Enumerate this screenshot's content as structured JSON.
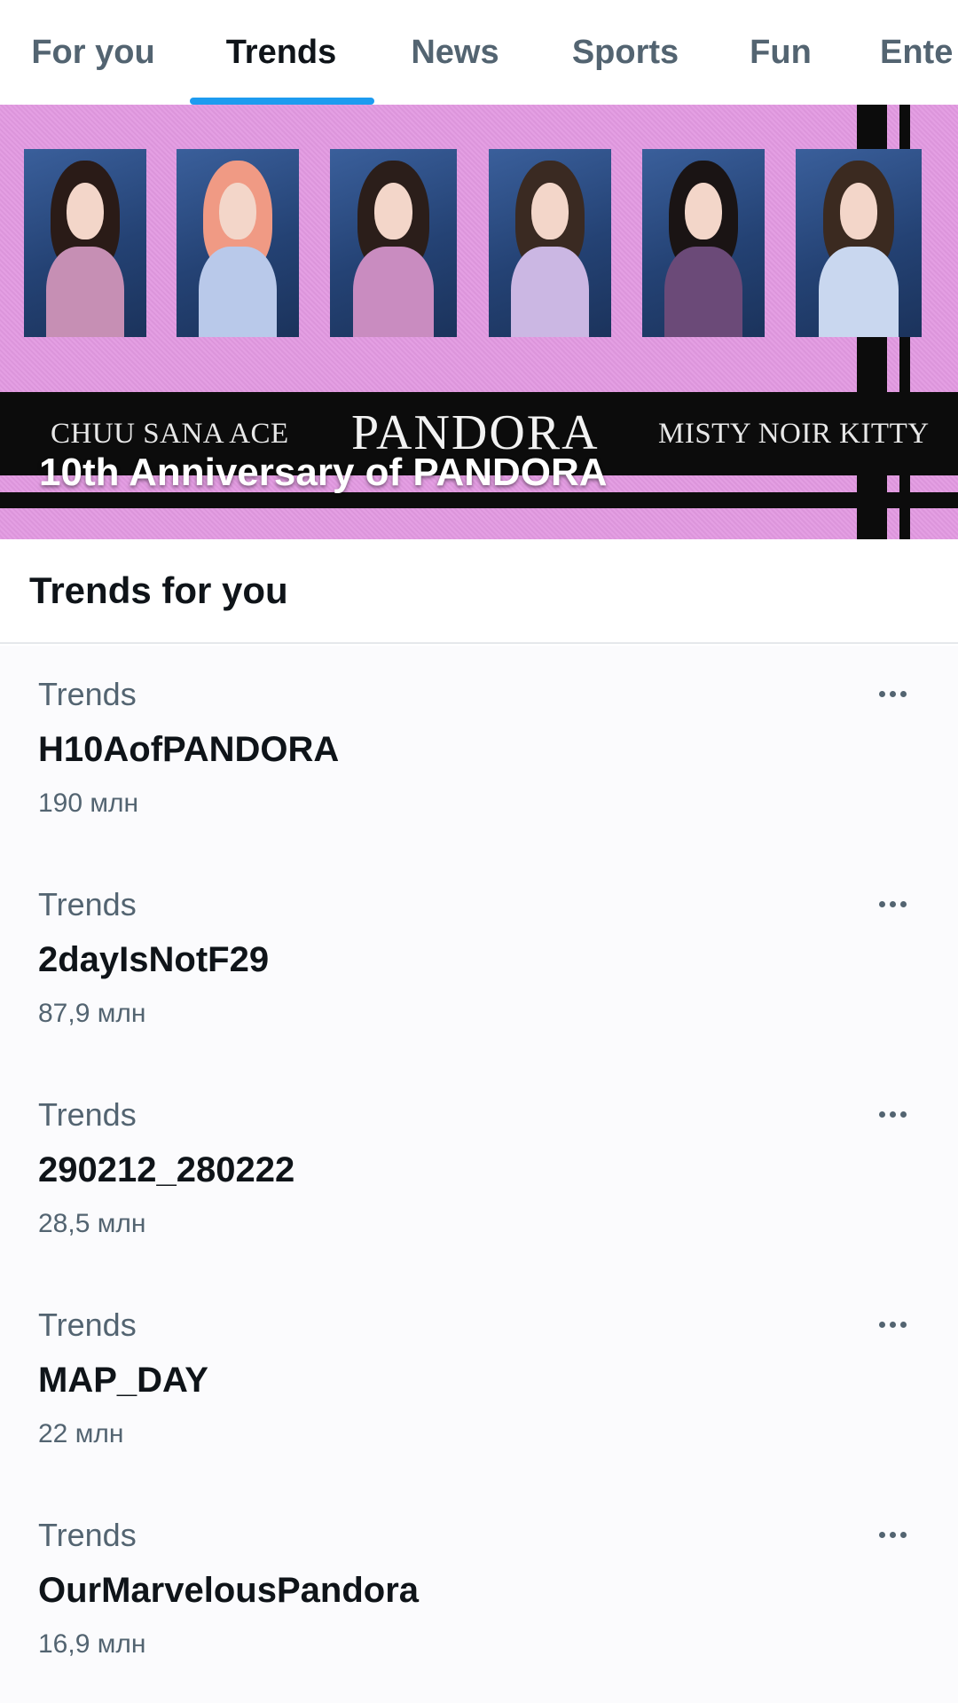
{
  "tabs": [
    {
      "label": "For you",
      "active": false
    },
    {
      "label": "Trends",
      "active": true
    },
    {
      "label": "News",
      "active": false
    },
    {
      "label": "Sports",
      "active": false
    },
    {
      "label": "Fun",
      "active": false
    },
    {
      "label": "Ente",
      "active": false
    }
  ],
  "banner": {
    "names_left": "CHUU SANA ACE",
    "brand": "PANDORA",
    "names_right": "MISTY NOIR KITTY",
    "caption": "10th Anniversary of PANDORA",
    "background_color": "#e39ae2"
  },
  "section": {
    "title": "Trends for you"
  },
  "trends": [
    {
      "context": "Trends",
      "name": "H10AofPANDORA",
      "count": "190 млн"
    },
    {
      "context": "Trends",
      "name": "2dayIsNotF29",
      "count": "87,9 млн"
    },
    {
      "context": "Trends",
      "name": "290212_280222",
      "count": "28,5 млн"
    },
    {
      "context": "Trends",
      "name": "MAP_DAY",
      "count": "22 млн"
    },
    {
      "context": "Trends",
      "name": "OurMarvelousPandora",
      "count": "16,9 млн"
    }
  ],
  "colors": {
    "accent": "#1d9bf0",
    "primary_text": "#0f1419",
    "secondary_text": "#536471"
  }
}
